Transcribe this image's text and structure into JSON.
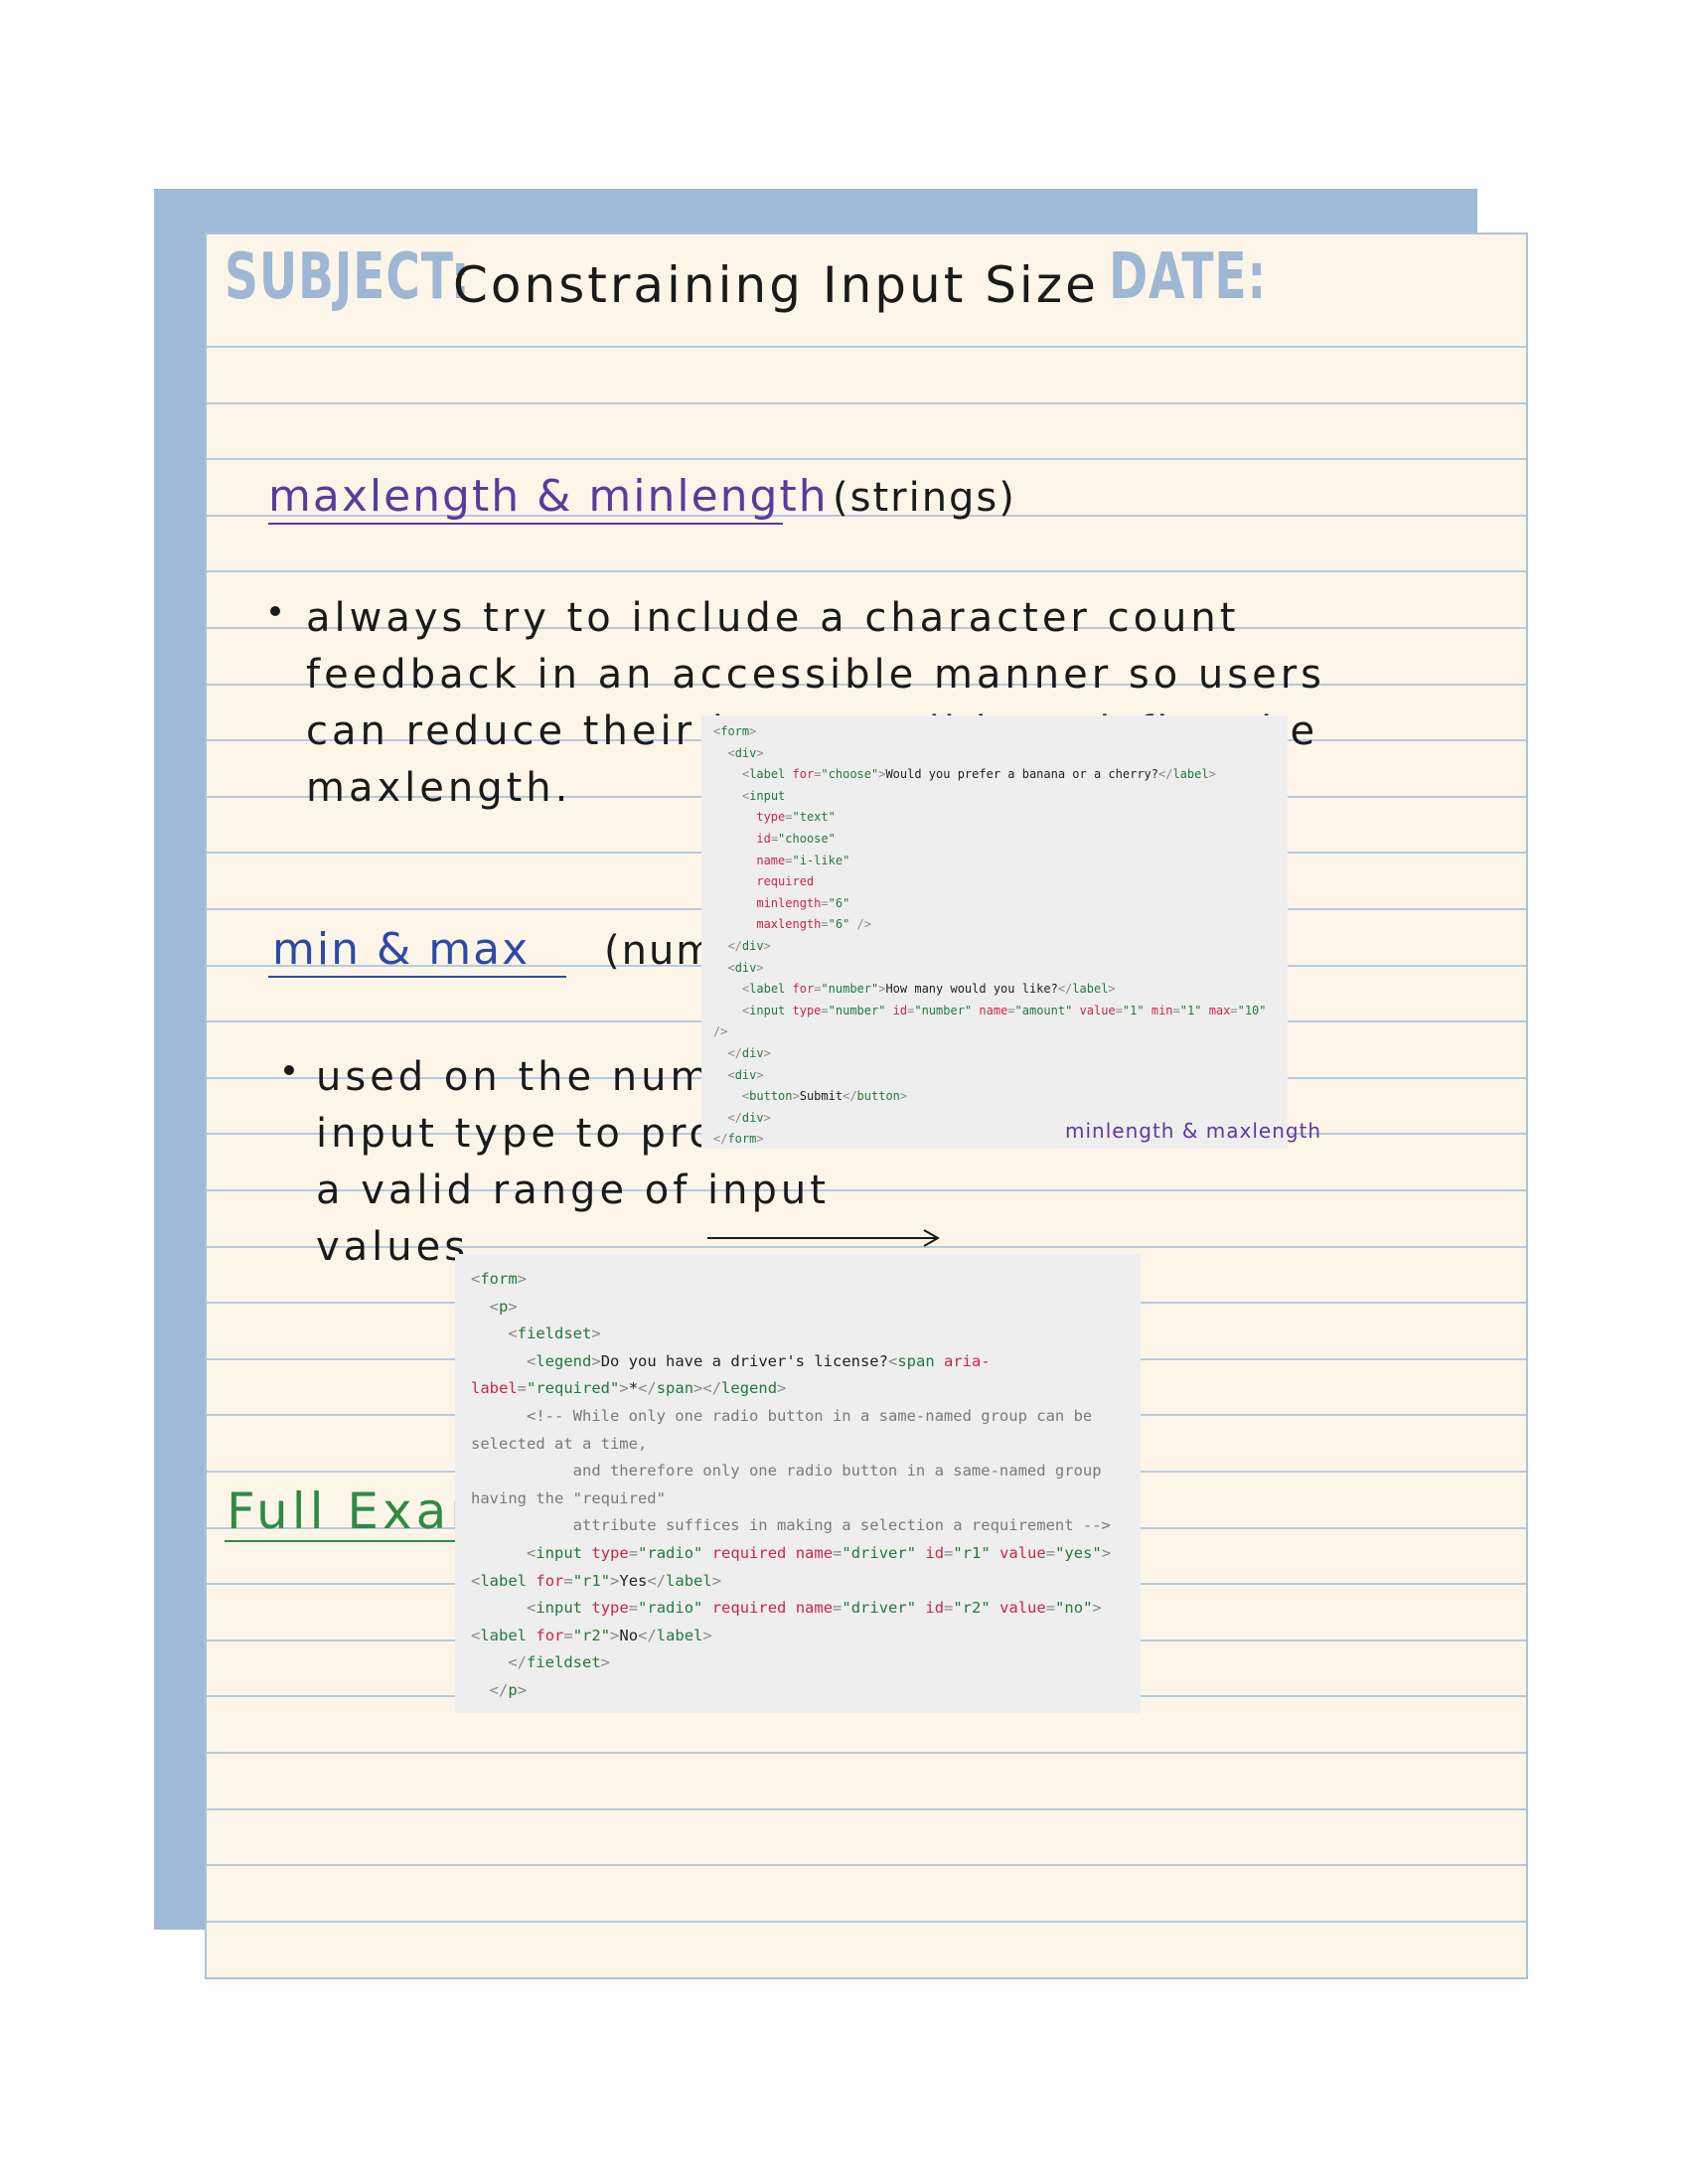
{
  "header": {
    "subject_label": "SUBJECT:",
    "subject_value": "Constraining Input Size",
    "date_label": "DATE:"
  },
  "section1": {
    "heading": "maxlength & minlength",
    "qualifier": "(strings)",
    "bullet_lines": [
      "always try to include a character count",
      "feedback in an accessible manner so users",
      "can reduce their input until it satisfies the",
      "maxlength."
    ]
  },
  "section2": {
    "heading": "min & max",
    "qualifier": "(numbers)",
    "bullet_lines": [
      "used on the number",
      "input type to provide",
      "a valid range of input",
      "values"
    ],
    "annotation": "minlength & maxlength"
  },
  "section3": {
    "heading": "Full Example:"
  },
  "code_snippet_1": [
    [
      [
        "c-punc",
        "<"
      ],
      [
        "c-tag",
        "form"
      ],
      [
        "c-punc",
        ">"
      ]
    ],
    [
      [
        "c-txt",
        "  "
      ],
      [
        "c-punc",
        "<"
      ],
      [
        "c-tag",
        "div"
      ],
      [
        "c-punc",
        ">"
      ]
    ],
    [
      [
        "c-txt",
        "    "
      ],
      [
        "c-punc",
        "<"
      ],
      [
        "c-tag",
        "label"
      ],
      [
        "c-txt",
        " "
      ],
      [
        "c-attr",
        "for"
      ],
      [
        "c-punc",
        "="
      ],
      [
        "c-val",
        "\"choose\""
      ],
      [
        "c-punc",
        ">"
      ],
      [
        "c-txt",
        "Would you prefer a banana or a cherry?"
      ],
      [
        "c-punc",
        "</"
      ],
      [
        "c-tag",
        "label"
      ],
      [
        "c-punc",
        ">"
      ]
    ],
    [
      [
        "c-txt",
        "    "
      ],
      [
        "c-punc",
        "<"
      ],
      [
        "c-tag",
        "input"
      ]
    ],
    [
      [
        "c-txt",
        "      "
      ],
      [
        "c-attr",
        "type"
      ],
      [
        "c-punc",
        "="
      ],
      [
        "c-val",
        "\"text\""
      ]
    ],
    [
      [
        "c-txt",
        "      "
      ],
      [
        "c-attr",
        "id"
      ],
      [
        "c-punc",
        "="
      ],
      [
        "c-val",
        "\"choose\""
      ]
    ],
    [
      [
        "c-txt",
        "      "
      ],
      [
        "c-attr",
        "name"
      ],
      [
        "c-punc",
        "="
      ],
      [
        "c-val",
        "\"i-like\""
      ]
    ],
    [
      [
        "c-txt",
        "      "
      ],
      [
        "c-attr",
        "required"
      ]
    ],
    [
      [
        "c-txt",
        "      "
      ],
      [
        "c-attr",
        "minlength"
      ],
      [
        "c-punc",
        "="
      ],
      [
        "c-val",
        "\"6\""
      ]
    ],
    [
      [
        "c-txt",
        "      "
      ],
      [
        "c-attr",
        "maxlength"
      ],
      [
        "c-punc",
        "="
      ],
      [
        "c-val",
        "\"6\""
      ],
      [
        "c-txt",
        " "
      ],
      [
        "c-punc",
        "/>"
      ]
    ],
    [
      [
        "c-txt",
        "  "
      ],
      [
        "c-punc",
        "</"
      ],
      [
        "c-tag",
        "div"
      ],
      [
        "c-punc",
        ">"
      ]
    ],
    [
      [
        "c-txt",
        "  "
      ],
      [
        "c-punc",
        "<"
      ],
      [
        "c-tag",
        "div"
      ],
      [
        "c-punc",
        ">"
      ]
    ],
    [
      [
        "c-txt",
        "    "
      ],
      [
        "c-punc",
        "<"
      ],
      [
        "c-tag",
        "label"
      ],
      [
        "c-txt",
        " "
      ],
      [
        "c-attr",
        "for"
      ],
      [
        "c-punc",
        "="
      ],
      [
        "c-val",
        "\"number\""
      ],
      [
        "c-punc",
        ">"
      ],
      [
        "c-txt",
        "How many would you like?"
      ],
      [
        "c-punc",
        "</"
      ],
      [
        "c-tag",
        "label"
      ],
      [
        "c-punc",
        ">"
      ]
    ],
    [
      [
        "c-txt",
        "    "
      ],
      [
        "c-punc",
        "<"
      ],
      [
        "c-tag",
        "input"
      ],
      [
        "c-txt",
        " "
      ],
      [
        "c-attr",
        "type"
      ],
      [
        "c-punc",
        "="
      ],
      [
        "c-val",
        "\"number\""
      ],
      [
        "c-txt",
        " "
      ],
      [
        "c-attr",
        "id"
      ],
      [
        "c-punc",
        "="
      ],
      [
        "c-val",
        "\"number\""
      ],
      [
        "c-txt",
        " "
      ],
      [
        "c-attr",
        "name"
      ],
      [
        "c-punc",
        "="
      ],
      [
        "c-val",
        "\"amount\""
      ],
      [
        "c-txt",
        " "
      ],
      [
        "c-attr",
        "value"
      ],
      [
        "c-punc",
        "="
      ],
      [
        "c-val",
        "\"1\""
      ],
      [
        "c-txt",
        " "
      ],
      [
        "c-attr",
        "min"
      ],
      [
        "c-punc",
        "="
      ],
      [
        "c-val",
        "\"1\""
      ],
      [
        "c-txt",
        " "
      ],
      [
        "c-attr",
        "max"
      ],
      [
        "c-punc",
        "="
      ],
      [
        "c-val",
        "\"10\""
      ]
    ],
    [
      [
        "c-punc",
        "/>"
      ]
    ],
    [
      [
        "c-txt",
        "  "
      ],
      [
        "c-punc",
        "</"
      ],
      [
        "c-tag",
        "div"
      ],
      [
        "c-punc",
        ">"
      ]
    ],
    [
      [
        "c-txt",
        "  "
      ],
      [
        "c-punc",
        "<"
      ],
      [
        "c-tag",
        "div"
      ],
      [
        "c-punc",
        ">"
      ]
    ],
    [
      [
        "c-txt",
        "    "
      ],
      [
        "c-punc",
        "<"
      ],
      [
        "c-tag",
        "button"
      ],
      [
        "c-punc",
        ">"
      ],
      [
        "c-txt",
        "Submit"
      ],
      [
        "c-punc",
        "</"
      ],
      [
        "c-tag",
        "button"
      ],
      [
        "c-punc",
        ">"
      ]
    ],
    [
      [
        "c-txt",
        "  "
      ],
      [
        "c-punc",
        "</"
      ],
      [
        "c-tag",
        "div"
      ],
      [
        "c-punc",
        ">"
      ]
    ],
    [
      [
        "c-punc",
        "</"
      ],
      [
        "c-tag",
        "form"
      ],
      [
        "c-punc",
        ">"
      ]
    ]
  ],
  "code_snippet_2": [
    [
      [
        "c-punc",
        "<"
      ],
      [
        "c-tag",
        "form"
      ],
      [
        "c-punc",
        ">"
      ]
    ],
    [
      [
        "c-txt",
        "  "
      ],
      [
        "c-punc",
        "<"
      ],
      [
        "c-tag",
        "p"
      ],
      [
        "c-punc",
        ">"
      ]
    ],
    [
      [
        "c-txt",
        "    "
      ],
      [
        "c-punc",
        "<"
      ],
      [
        "c-tag",
        "fieldset"
      ],
      [
        "c-punc",
        ">"
      ]
    ],
    [
      [
        "c-txt",
        "      "
      ],
      [
        "c-punc",
        "<"
      ],
      [
        "c-tag",
        "legend"
      ],
      [
        "c-punc",
        ">"
      ],
      [
        "c-txt",
        "Do you have a driver's license?"
      ],
      [
        "c-punc",
        "<"
      ],
      [
        "c-tag",
        "span"
      ],
      [
        "c-txt",
        " "
      ],
      [
        "c-attr",
        "aria-"
      ]
    ],
    [
      [
        "c-attr",
        "label"
      ],
      [
        "c-punc",
        "="
      ],
      [
        "c-val",
        "\"required\""
      ],
      [
        "c-punc",
        ">"
      ],
      [
        "c-txt",
        "*"
      ],
      [
        "c-punc",
        "</"
      ],
      [
        "c-tag",
        "span"
      ],
      [
        "c-punc",
        "></"
      ],
      [
        "c-tag",
        "legend"
      ],
      [
        "c-punc",
        ">"
      ]
    ],
    [
      [
        "c-txt",
        "      "
      ],
      [
        "c-com",
        "<!-- While only one radio button in a same-named group can be"
      ]
    ],
    [
      [
        "c-com",
        "selected at a time,"
      ]
    ],
    [
      [
        "c-com",
        "           and therefore only one radio button in a same-named group"
      ]
    ],
    [
      [
        "c-com",
        "having the \"required\""
      ]
    ],
    [
      [
        "c-com",
        "           attribute suffices in making a selection a requirement -->"
      ]
    ],
    [
      [
        "c-txt",
        "      "
      ],
      [
        "c-punc",
        "<"
      ],
      [
        "c-tag",
        "input"
      ],
      [
        "c-txt",
        " "
      ],
      [
        "c-attr",
        "type"
      ],
      [
        "c-punc",
        "="
      ],
      [
        "c-val",
        "\"radio\""
      ],
      [
        "c-txt",
        " "
      ],
      [
        "c-attr",
        "required"
      ],
      [
        "c-txt",
        " "
      ],
      [
        "c-attr",
        "name"
      ],
      [
        "c-punc",
        "="
      ],
      [
        "c-val",
        "\"driver\""
      ],
      [
        "c-txt",
        " "
      ],
      [
        "c-attr",
        "id"
      ],
      [
        "c-punc",
        "="
      ],
      [
        "c-val",
        "\"r1\""
      ],
      [
        "c-txt",
        " "
      ],
      [
        "c-attr",
        "value"
      ],
      [
        "c-punc",
        "="
      ],
      [
        "c-val",
        "\"yes\""
      ],
      [
        "c-punc",
        ">"
      ]
    ],
    [
      [
        "c-punc",
        "<"
      ],
      [
        "c-tag",
        "label"
      ],
      [
        "c-txt",
        " "
      ],
      [
        "c-attr",
        "for"
      ],
      [
        "c-punc",
        "="
      ],
      [
        "c-val",
        "\"r1\""
      ],
      [
        "c-punc",
        ">"
      ],
      [
        "c-txt",
        "Yes"
      ],
      [
        "c-punc",
        "</"
      ],
      [
        "c-tag",
        "label"
      ],
      [
        "c-punc",
        ">"
      ]
    ],
    [
      [
        "c-txt",
        "      "
      ],
      [
        "c-punc",
        "<"
      ],
      [
        "c-tag",
        "input"
      ],
      [
        "c-txt",
        " "
      ],
      [
        "c-attr",
        "type"
      ],
      [
        "c-punc",
        "="
      ],
      [
        "c-val",
        "\"radio\""
      ],
      [
        "c-txt",
        " "
      ],
      [
        "c-attr",
        "required"
      ],
      [
        "c-txt",
        " "
      ],
      [
        "c-attr",
        "name"
      ],
      [
        "c-punc",
        "="
      ],
      [
        "c-val",
        "\"driver\""
      ],
      [
        "c-txt",
        " "
      ],
      [
        "c-attr",
        "id"
      ],
      [
        "c-punc",
        "="
      ],
      [
        "c-val",
        "\"r2\""
      ],
      [
        "c-txt",
        " "
      ],
      [
        "c-attr",
        "value"
      ],
      [
        "c-punc",
        "="
      ],
      [
        "c-val",
        "\"no\""
      ],
      [
        "c-punc",
        ">"
      ]
    ],
    [
      [
        "c-punc",
        "<"
      ],
      [
        "c-tag",
        "label"
      ],
      [
        "c-txt",
        " "
      ],
      [
        "c-attr",
        "for"
      ],
      [
        "c-punc",
        "="
      ],
      [
        "c-val",
        "\"r2\""
      ],
      [
        "c-punc",
        ">"
      ],
      [
        "c-txt",
        "No"
      ],
      [
        "c-punc",
        "</"
      ],
      [
        "c-tag",
        "label"
      ],
      [
        "c-punc",
        ">"
      ]
    ],
    [
      [
        "c-txt",
        "    "
      ],
      [
        "c-punc",
        "</"
      ],
      [
        "c-tag",
        "fieldset"
      ],
      [
        "c-punc",
        ">"
      ]
    ],
    [
      [
        "c-txt",
        "  "
      ],
      [
        "c-punc",
        "</"
      ],
      [
        "c-tag",
        "p"
      ],
      [
        "c-punc",
        ">"
      ]
    ]
  ],
  "colors": {
    "paper": "#fdf5e7",
    "back_sheet": "#9fbbd8",
    "rule": "#b6cbdf",
    "label_blue": "#9db7d4",
    "purple": "#5b3a9e",
    "blue": "#2c4aa8",
    "green": "#2f8a45"
  }
}
